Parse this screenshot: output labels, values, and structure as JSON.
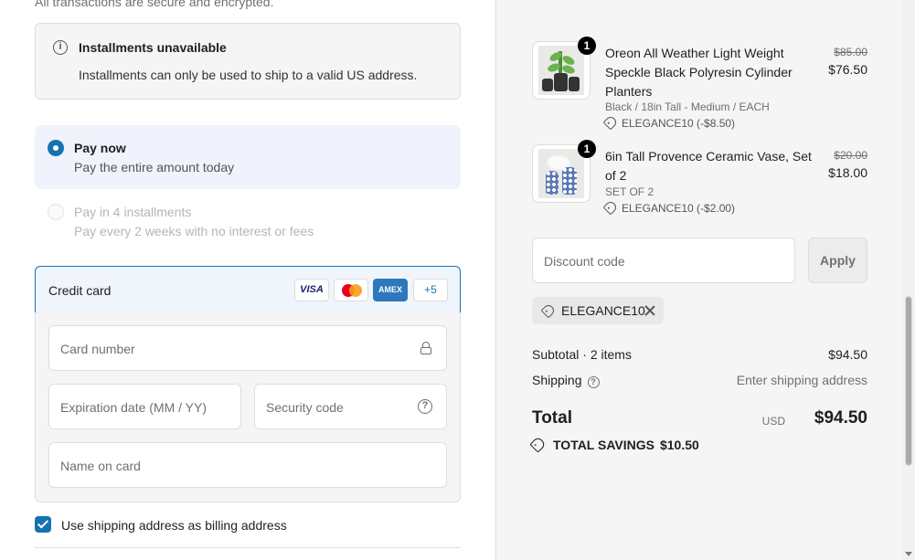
{
  "payment": {
    "secure_note": "All transactions are secure and encrypted.",
    "notice": {
      "title": "Installments unavailable",
      "description": "Installments can only be used to ship to a valid US address."
    },
    "options": [
      {
        "title": "Pay now",
        "subtitle": "Pay the entire amount today",
        "selected": true
      },
      {
        "title": "Pay in 4 installments",
        "subtitle": "Pay every 2 weeks with no interest or fees",
        "selected": false,
        "disabled": true
      }
    ],
    "credit_card": {
      "label": "Credit card",
      "logos": [
        "VISA",
        "Mastercard",
        "AMEX"
      ],
      "more_label": "+5",
      "card_number_placeholder": "Card number",
      "expiry_placeholder": "Expiration date (MM / YY)",
      "security_placeholder": "Security code",
      "name_placeholder": "Name on card"
    },
    "billing_checkbox": {
      "label": "Use shipping address as billing address",
      "checked": true
    }
  },
  "summary": {
    "items": [
      {
        "quantity": "1",
        "name": "Oreon All Weather Light Weight Speckle Black Polyresin Cylinder Planters",
        "variant": "Black / 18in Tall - Medium / EACH",
        "discount": "ELEGANCE10 (-$8.50)",
        "original_price": "$85.00",
        "price": "$76.50"
      },
      {
        "quantity": "1",
        "name": "6in Tall Provence Ceramic Vase, Set of 2",
        "variant": "SET OF 2",
        "discount": "ELEGANCE10 (-$2.00)",
        "original_price": "$20.00",
        "price": "$18.00"
      }
    ],
    "discount_placeholder": "Discount code",
    "apply_label": "Apply",
    "applied_code": "ELEGANCE10",
    "subtotal_label": "Subtotal · 2 items",
    "subtotal_value": "$94.50",
    "shipping_label": "Shipping",
    "shipping_value": "Enter shipping address",
    "total_label": "Total",
    "currency": "USD",
    "total_value": "$94.50",
    "savings_label": "TOTAL SAVINGS",
    "savings_value": "$10.50"
  },
  "colors": {
    "accent": "#1773b0",
    "panel": "#f5f5f5",
    "selected_bg": "#f0f2fc"
  }
}
